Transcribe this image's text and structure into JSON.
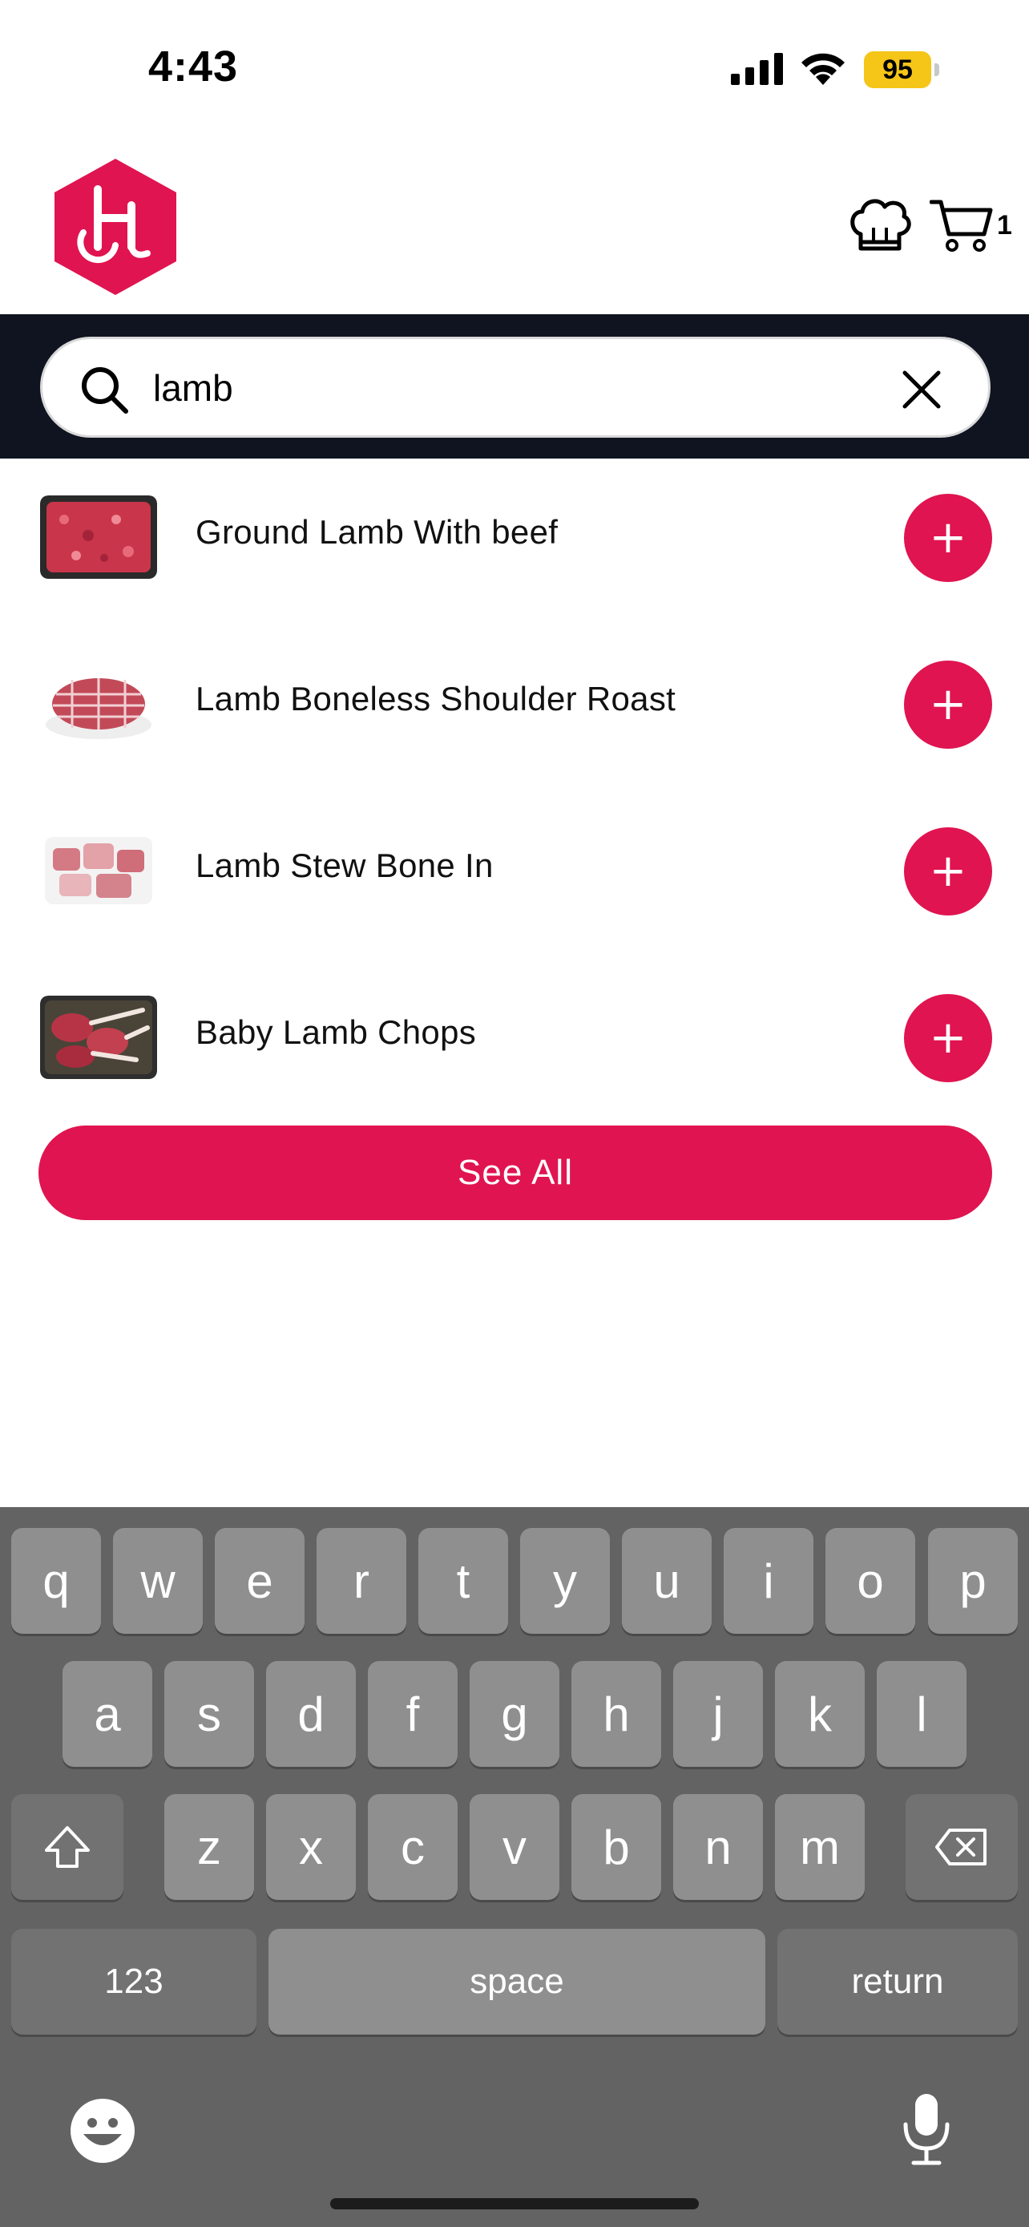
{
  "status_bar": {
    "time": "4:43",
    "battery": "95",
    "battery_color": "#f5c518"
  },
  "header": {
    "logo_icon": "brand-hexagon-logo",
    "chef_icon": "chef-hat-icon",
    "cart_icon": "shopping-cart-icon",
    "cart_count": "1"
  },
  "search": {
    "value": "lamb",
    "search_icon": "search-icon",
    "clear_icon": "close-icon"
  },
  "results": [
    {
      "name": "Ground Lamb With beef",
      "add_label": "+"
    },
    {
      "name": "Lamb Boneless Shoulder Roast",
      "add_label": "+"
    },
    {
      "name": "Lamb Stew Bone In",
      "add_label": "+"
    },
    {
      "name": "Baby Lamb Chops",
      "add_label": "+"
    }
  ],
  "see_all_label": "See All",
  "colors": {
    "accent": "#e01450",
    "search_band": "#0f1420",
    "keyboard_bg": "#636363"
  },
  "keyboard": {
    "row1": [
      "q",
      "w",
      "e",
      "r",
      "t",
      "y",
      "u",
      "i",
      "o",
      "p"
    ],
    "row2": [
      "a",
      "s",
      "d",
      "f",
      "g",
      "h",
      "j",
      "k",
      "l"
    ],
    "row3": [
      "z",
      "x",
      "c",
      "v",
      "b",
      "n",
      "m"
    ],
    "numbers_label": "123",
    "space_label": "space",
    "return_label": "return"
  }
}
